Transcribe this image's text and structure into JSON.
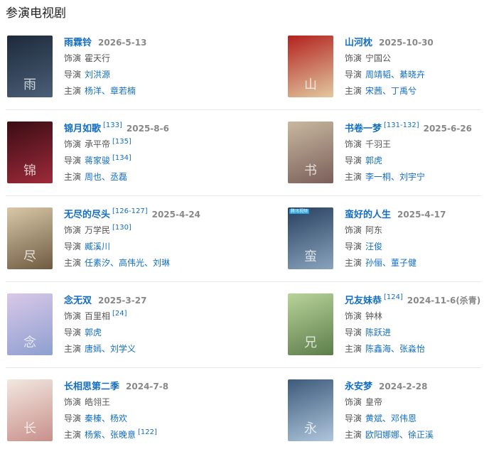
{
  "section_title": "参演电视剧",
  "labels": {
    "role": "饰演",
    "director": "导演",
    "cast": "主演"
  },
  "rows": [
    {
      "left": {
        "title": "雨霖铃",
        "title_ref": "",
        "date": "2026-5-13",
        "date_ref": "",
        "role": "霍天行",
        "role_ref": "",
        "director": "刘洪源",
        "director_ref": "",
        "cast": "杨洋、章若楠",
        "cast_ref": "",
        "poster": {
          "colors": [
            "#1d2a3a",
            "#4b5f78"
          ],
          "badge": "",
          "glyph": "雨"
        }
      },
      "right": {
        "title": "山河枕",
        "title_ref": "",
        "date": "2025-10-30",
        "date_ref": "",
        "role": "宁国公",
        "role_ref": "",
        "director": "周靖韬、綦晓卉",
        "director_ref": "",
        "cast": "宋茜、丁禹兮",
        "cast_ref": "",
        "poster": {
          "colors": [
            "#b3211e",
            "#e2c9a0"
          ],
          "badge": "",
          "glyph": "山"
        }
      }
    },
    {
      "left": {
        "title": "锦月如歌",
        "title_ref": "[133]",
        "date": "2025-8-6",
        "date_ref": "",
        "role": "承平帝",
        "role_ref": "[135]",
        "director": "蒋家骏",
        "director_ref": "[134]",
        "cast": "周也、丞磊",
        "cast_ref": "",
        "poster": {
          "colors": [
            "#3a0d14",
            "#9e2a3a"
          ],
          "badge": "",
          "glyph": "锦"
        }
      },
      "right": {
        "title": "书卷一梦",
        "title_ref": "[131-132]",
        "date": "2025-6-26",
        "date_ref": "",
        "role": "千羽王",
        "role_ref": "",
        "director": "郭虎",
        "director_ref": "",
        "cast": "李一桐、刘宇宁",
        "cast_ref": "",
        "poster": {
          "colors": [
            "#c9b8a0",
            "#7a5f5a"
          ],
          "badge": "",
          "glyph": "书"
        }
      }
    },
    {
      "left": {
        "title": "无尽的尽头",
        "title_ref": "[126-127]",
        "date": "2025-4-24",
        "date_ref": "",
        "role": "万学民",
        "role_ref": "[130]",
        "director": "臧溪川",
        "director_ref": "",
        "cast": "任素汐、高伟光、刘琳",
        "cast_ref": "",
        "poster": {
          "colors": [
            "#d8c8a8",
            "#6e5a42"
          ],
          "badge": "",
          "glyph": "尽"
        }
      },
      "right": {
        "title": "蛮好的人生",
        "title_ref": "",
        "date": "2025-4-17",
        "date_ref": "",
        "role": "阿东",
        "role_ref": "",
        "director": "汪俊",
        "director_ref": "",
        "cast": "孙俪、董子健",
        "cast_ref": "",
        "poster": {
          "colors": [
            "#27405e",
            "#8aa3bd"
          ],
          "badge": "腾讯视频",
          "glyph": "蛮"
        }
      }
    },
    {
      "left": {
        "title": "念无双",
        "title_ref": "",
        "date": "2025-3-27",
        "date_ref": "",
        "role": "百里相",
        "role_ref": "[24]",
        "director": "郭虎",
        "director_ref": "",
        "cast": "唐嫣、刘学义",
        "cast_ref": "",
        "poster": {
          "colors": [
            "#d9c8e8",
            "#8e9fd0"
          ],
          "badge": "",
          "glyph": "念"
        }
      },
      "right": {
        "title": "兄友妹恭",
        "title_ref": "[124]",
        "date": "2024-11-6(杀青)",
        "date_ref": "",
        "role": "钟林",
        "role_ref": "",
        "director": "陈跃进",
        "director_ref": "",
        "cast": "陈鑫海、张淼怡",
        "cast_ref": "",
        "poster": {
          "colors": [
            "#b9d39a",
            "#5c7d4a"
          ],
          "badge": "",
          "glyph": "兄"
        }
      }
    },
    {
      "left": {
        "title": "长相思第二季",
        "title_ref": "",
        "date": "2024-7-8",
        "date_ref": "",
        "role": "皓翎王",
        "role_ref": "",
        "director": "秦榛、杨欢",
        "director_ref": "",
        "cast": "杨紫、张晚意",
        "cast_ref": "[122]",
        "poster": {
          "colors": [
            "#f1e8e0",
            "#c98f8a"
          ],
          "badge": "",
          "glyph": "长"
        }
      },
      "right": {
        "title": "永安梦",
        "title_ref": "",
        "date": "2024-2-28",
        "date_ref": "",
        "role": "皇帝",
        "role_ref": "",
        "director": "黄斌、邓伟恩",
        "director_ref": "",
        "cast": "欧阳娜娜、徐正溪",
        "cast_ref": "",
        "poster": {
          "colors": [
            "#3d5a7a",
            "#aec6dc"
          ],
          "badge": "",
          "glyph": "永"
        }
      }
    }
  ]
}
